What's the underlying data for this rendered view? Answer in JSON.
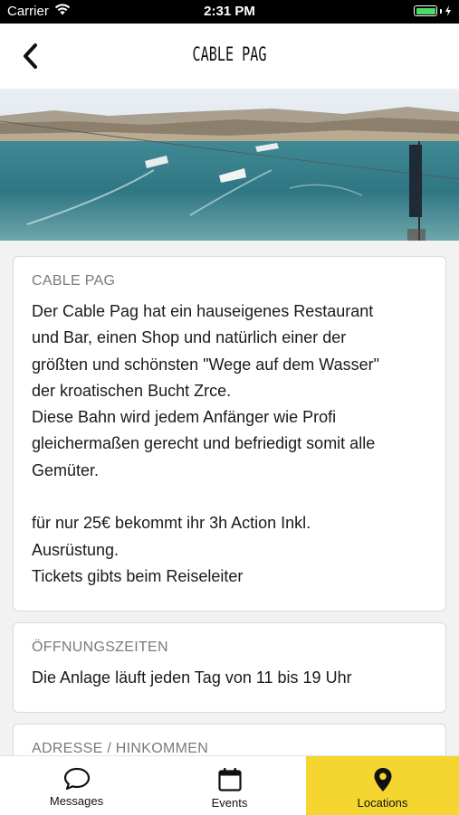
{
  "status_bar": {
    "carrier": "Carrier",
    "time": "2:31 PM",
    "battery_color": "#4cd964"
  },
  "nav": {
    "title": "CABLE PAG",
    "back_icon": "chevron-left-icon"
  },
  "cards": [
    {
      "title": "CABLE PAG",
      "lines": [
        "Der Cable Pag hat ein hauseigenes Restaurant",
        "und Bar, einen Shop und natürlich einer der",
        "größten und schönsten \"Wege auf dem Wasser\"",
        "der kroatischen Bucht Zrce.",
        "Diese Bahn wird jedem Anfänger wie Profi",
        "gleichermaßen gerecht und befriedigt somit alle",
        "Gemüter.",
        "",
        "für nur 25€ bekommt ihr 3h Action Inkl.",
        "Ausrüstung.",
        "Tickets gibts beim Reiseleiter"
      ]
    },
    {
      "title": "ÖFFNUNGSZEITEN",
      "lines": [
        "Die Anlage läuft jeden Tag von 11 bis 19 Uhr"
      ]
    },
    {
      "title": "ADRESSE / HINKOMMEN",
      "lines": []
    }
  ],
  "tabs": [
    {
      "label": "Messages",
      "icon": "chat-bubble-icon",
      "active": false
    },
    {
      "label": "Events",
      "icon": "calendar-icon",
      "active": false
    },
    {
      "label": "Locations",
      "icon": "map-pin-icon",
      "active": true
    }
  ],
  "colors": {
    "accent": "#f5d530",
    "background": "#f2f2f2"
  }
}
